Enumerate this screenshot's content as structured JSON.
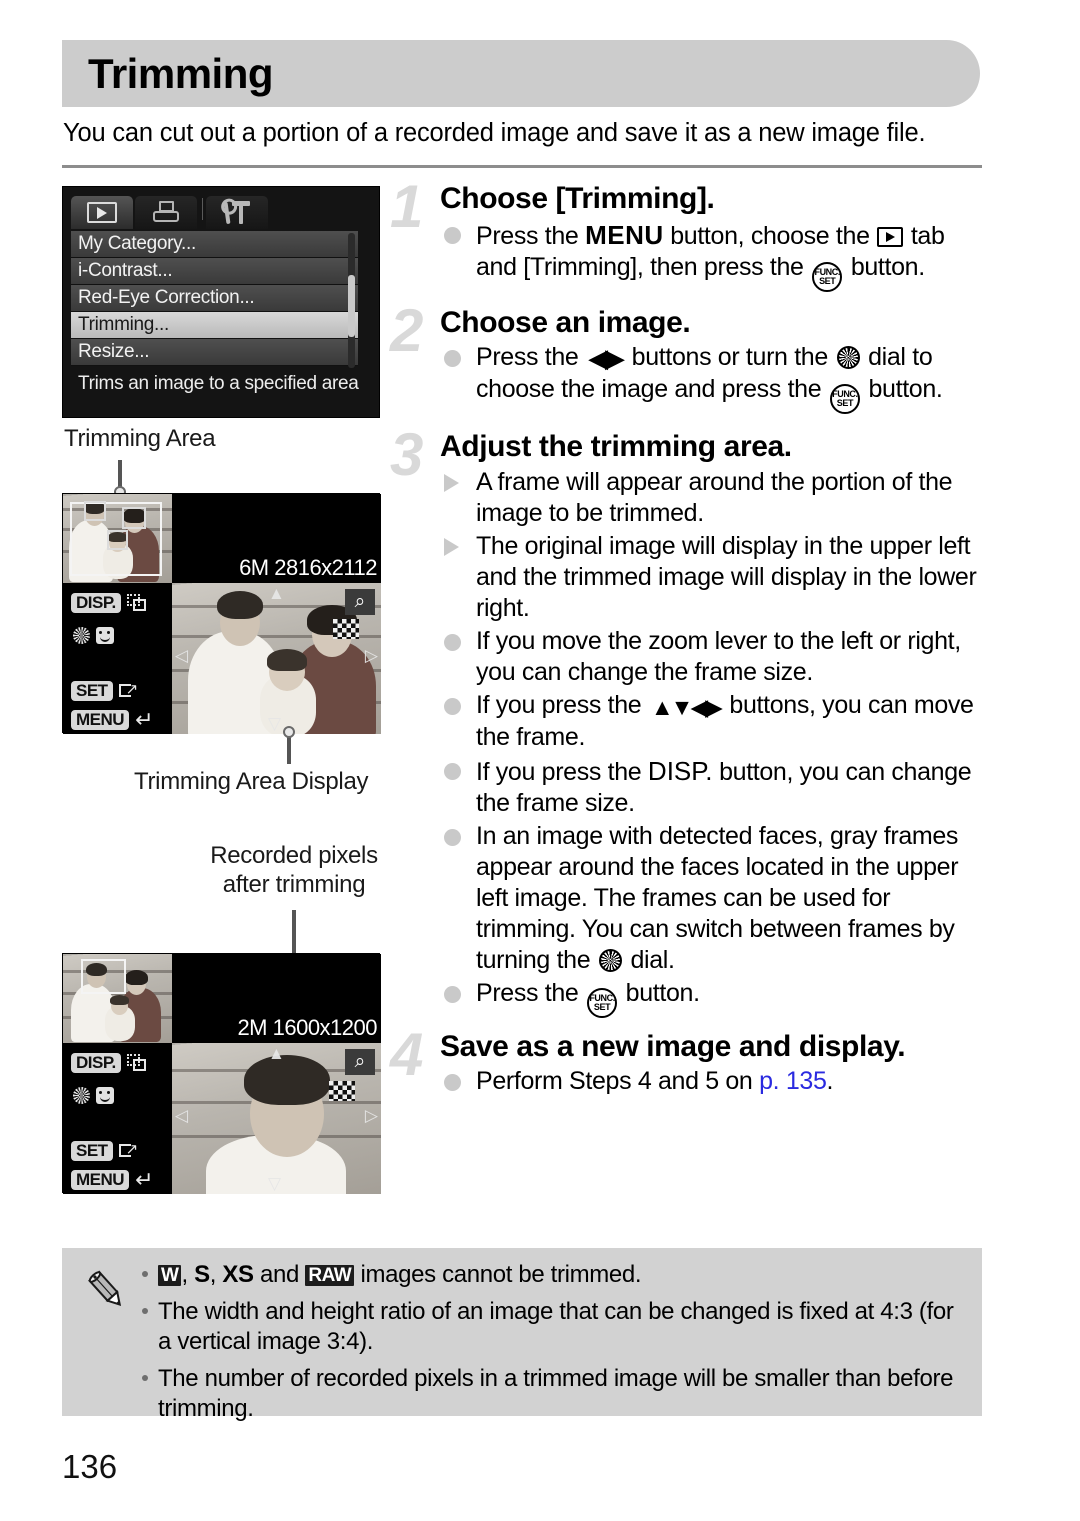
{
  "header": {
    "title": "Trimming",
    "intro": "You can cut out a portion of a recorded image and save it as a new image file."
  },
  "menu_screenshot": {
    "tabs": [
      {
        "name": "playback-tab",
        "icon": "play-icon",
        "active": true
      },
      {
        "name": "print-tab",
        "icon": "printer-icon",
        "active": false
      },
      {
        "name": "settings-tab",
        "icon": "wrench-hammer-icon",
        "active": false
      }
    ],
    "items": [
      {
        "label": "My Category...",
        "selected": false
      },
      {
        "label": "i-Contrast...",
        "selected": false
      },
      {
        "label": "Red-Eye Correction...",
        "selected": false
      },
      {
        "label": "Trimming...",
        "selected": true
      },
      {
        "label": "Resize...",
        "selected": false
      }
    ],
    "hint": "Trims an image to a specified area"
  },
  "figures": {
    "first": {
      "callout_top": "Trimming Area",
      "callout_bottom": "Trimming Area Display",
      "pixels": "6M 2816x2112",
      "guide": {
        "disp_label": "DISP.",
        "disp_icon": "frame-resize-icon",
        "dial_icon": "control-dial-icon",
        "face_icon": "face-select-icon",
        "set_label": "SET",
        "set_icon": "save-icon",
        "menu_label": "MENU",
        "menu_icon": "return-arrow-icon",
        "zoom_icon": "magnifier-icon",
        "checker_icon": "checker-pattern-icon"
      }
    },
    "second": {
      "callout_top": "Recorded pixels after trimming",
      "callout_top_line1": "Recorded pixels",
      "callout_top_line2": "after trimming",
      "pixels": "2M 1600x1200",
      "guide": {
        "disp_label": "DISP.",
        "set_label": "SET",
        "menu_label": "MENU"
      }
    }
  },
  "steps": [
    {
      "number": "1",
      "heading": "Choose [Trimming].",
      "bullets": [
        {
          "marker": "dot",
          "parts": [
            {
              "t": "text",
              "v": "Press the "
            },
            {
              "t": "glyph",
              "v": "MENU",
              "name": "menu-button-glyph"
            },
            {
              "t": "text",
              "v": " button, choose the "
            },
            {
              "t": "glyph",
              "v": "playback",
              "name": "playback-tab-glyph"
            },
            {
              "t": "text",
              "v": " tab and [Trimming], then press the "
            },
            {
              "t": "glyph",
              "v": "FUNC.SET",
              "name": "func-set-button-glyph"
            },
            {
              "t": "text",
              "v": " button."
            }
          ]
        }
      ]
    },
    {
      "number": "2",
      "heading": "Choose an image.",
      "bullets": [
        {
          "marker": "dot",
          "parts": [
            {
              "t": "text",
              "v": "Press the "
            },
            {
              "t": "glyph",
              "v": "left-right",
              "name": "left-right-buttons-glyph"
            },
            {
              "t": "text",
              "v": " buttons or turn the "
            },
            {
              "t": "glyph",
              "v": "dial",
              "name": "control-dial-glyph"
            },
            {
              "t": "text",
              "v": " dial to choose the image and press the "
            },
            {
              "t": "glyph",
              "v": "FUNC.SET",
              "name": "func-set-button-glyph"
            },
            {
              "t": "text",
              "v": " button."
            }
          ]
        }
      ]
    },
    {
      "number": "3",
      "heading": "Adjust the trimming area.",
      "bullets": [
        {
          "marker": "triangle",
          "text": "A frame will appear around the portion of the image to be trimmed."
        },
        {
          "marker": "triangle",
          "text": "The original image will display in the upper left and the trimmed image will display in the lower right."
        },
        {
          "marker": "dot",
          "text": "If you move the zoom lever to the left or right, you can change the frame size."
        },
        {
          "marker": "dot",
          "text_before": "If you press the ",
          "glyph": "up-down-left-right",
          "text_after": " buttons, you can move the frame."
        },
        {
          "marker": "dot",
          "text_before": "If you press the ",
          "glyph": "DISP.",
          "text_after": " button, you can change the frame size."
        },
        {
          "marker": "dot",
          "text_before": "In an image with detected faces, gray frames appear around the faces located in the upper left image. The frames can be used for trimming. You can switch between frames by turning the ",
          "glyph": "dial",
          "text_after": " dial."
        },
        {
          "marker": "dot",
          "text_before": "Press the ",
          "glyph": "FUNC.SET",
          "text_after": " button."
        }
      ]
    },
    {
      "number": "4",
      "heading": "Save as a new image and display.",
      "bullets": [
        {
          "marker": "dot",
          "text_before": "Perform Steps 4 and 5 on ",
          "link": "p. 135",
          "text_after": "."
        }
      ]
    }
  ],
  "notes": {
    "icon": "pencil-icon",
    "items": [
      {
        "symbols": [
          "W",
          "S",
          "XS",
          "RAW"
        ],
        "text": " images cannot be trimmed.",
        "joiner1": ", ",
        "joiner2": ", ",
        "joiner3": " and "
      },
      {
        "text": "The width and height ratio of an image that can be changed is fixed at 4:3 (for a vertical image 3:4)."
      },
      {
        "text": "The number of recorded pixels in a trimmed image will be smaller than before trimming."
      }
    ]
  },
  "folio": "136",
  "colors": {
    "header_bar": "#cccccc",
    "notes_bg": "#d2d2d2",
    "step_number": "#d9d9d9",
    "link": "#2a2ae0",
    "rule": "#8d8d8d"
  }
}
